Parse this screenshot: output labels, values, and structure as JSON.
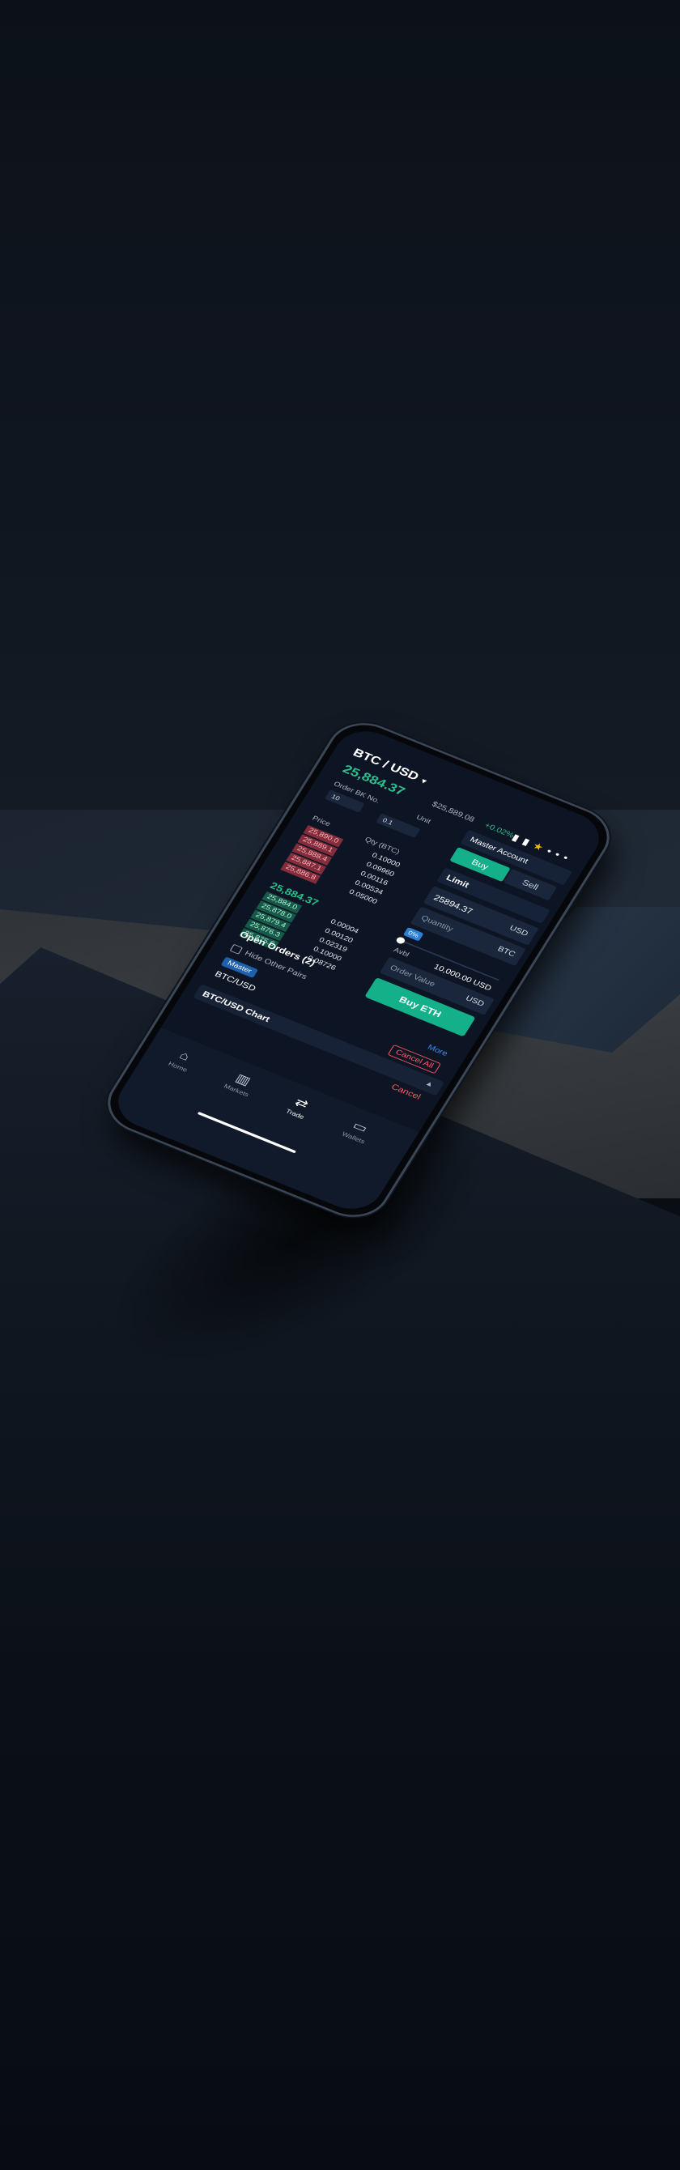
{
  "header": {
    "pair": "BTC / USD",
    "last_price": "25,884.37",
    "ref_price": "$25,889.08",
    "change": "+0.02%",
    "star_color": "#f5b800"
  },
  "orderbook": {
    "order_bk_no_label": "Order BK No.",
    "order_bk_no_value": "10",
    "unit_label": "Unit",
    "unit_value": "0.1",
    "price_col": "Price",
    "qty_col": "Qty (BTC)",
    "asks": [
      "25,890.0",
      "25,889.1",
      "25,888.4",
      "25,887.1",
      "25,886.8"
    ],
    "ask_qty": [
      "0.10000",
      "0.09960",
      "0.00116",
      "0.00534",
      "0.05000"
    ],
    "mid_price": "25,884.37",
    "bids": [
      "25,884.0",
      "25,878.0",
      "25,879.4",
      "25,876.3",
      "25,875.6"
    ],
    "bid_qty": [
      "0.00004",
      "0.00120",
      "0.02319",
      "0.10000",
      "0.08726"
    ]
  },
  "form": {
    "account": "Master Account",
    "buy_tab": "Buy",
    "sell_tab": "Sell",
    "order_type": "Limit",
    "price_value": "25894.37",
    "price_ccy": "USD",
    "qty_placeholder": "Quantity",
    "qty_ccy": "BTC",
    "pct": "0%",
    "avbl_label": "Avbl",
    "avbl_value": "10,000.00 USD",
    "ov_placeholder": "Order Value",
    "ov_ccy": "USD",
    "buy_button": "Buy ETH"
  },
  "orders": {
    "title": "Open Orders (2)",
    "hide_pairs": "Hide Other Pairs",
    "badge": "Master",
    "pair": "BTC/USD",
    "more": "More",
    "cancel_all": "Cancel All",
    "chart_label": "BTC/USD Chart",
    "cancel": "Cancel"
  },
  "tabs": [
    {
      "label": "Home",
      "icon": "home-icon"
    },
    {
      "label": "Markets",
      "icon": "markets-icon"
    },
    {
      "label": "Trade",
      "icon": "trade-icon"
    },
    {
      "label": "Wallets",
      "icon": "wallets-icon"
    }
  ],
  "colors": {
    "accent_green": "#13b08a",
    "ask_red": "#ff5864",
    "link_blue": "#3f8cf0",
    "screen_bg": "#0d1524"
  }
}
